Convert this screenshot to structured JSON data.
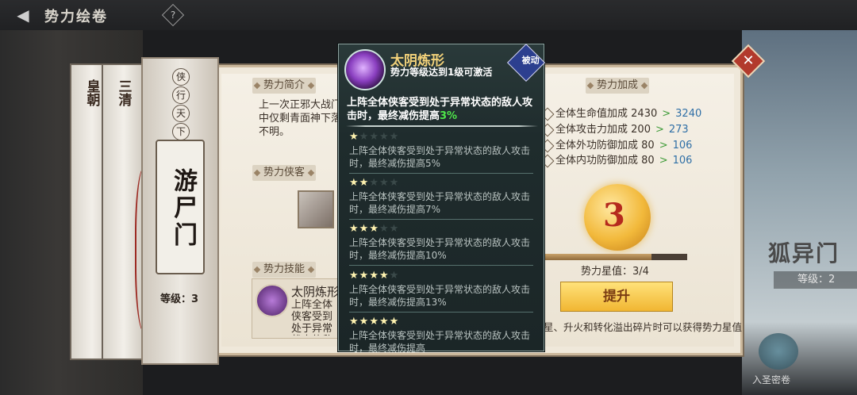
{
  "header": {
    "title": "势力绘卷",
    "help": "?"
  },
  "banner": {
    "motto": [
      "侠",
      "行",
      "天",
      "下"
    ],
    "name": "游尸门",
    "level_label": "等级：3"
  },
  "background": {
    "left_scrolls": [
      "皇朝",
      "三清"
    ],
    "right_card": {
      "name": "狐异门",
      "level": "等级：2"
    },
    "bottom_right_label": "入圣密卷"
  },
  "panel": {
    "intro_tag": "势力简介",
    "intro_text": "上一次正邪大战门中仅剩青面神下落不明。",
    "heroes_tag": "势力侠客",
    "skill_tag": "势力技能",
    "skill_name": "太阴炼形",
    "skill_desc": "上阵全体侠客受到处于异常状态的敌人攻击时，最终减",
    "bonus_tag": "势力加成",
    "bonuses": [
      {
        "label": "全体生命值加成",
        "current": "2430",
        "next": "3240"
      },
      {
        "label": "全体攻击力加成",
        "current": "200",
        "next": "273"
      },
      {
        "label": "全体外功防御加成",
        "current": "80",
        "next": "106"
      },
      {
        "label": "全体内功防御加成",
        "current": "80",
        "next": "106"
      }
    ],
    "star_medal": "3",
    "star_progress": 0.75,
    "star_value": "势力星值：3/4",
    "upgrade_button": "提升",
    "tip": "星、升火和转化溢出碎片时可以获得势力星值",
    "close": "✕"
  },
  "tooltip": {
    "title": "太阴炼形",
    "subtitle": "势力等级达到1级可激活",
    "badge": "被动",
    "main_text": "上阵全体侠客受到处于异常状态的敌人攻击时，最终减伤提高",
    "main_value": "3%",
    "tiers": [
      {
        "stars": 1,
        "text": "上阵全体侠客受到处于异常状态的敌人攻击时，最终减伤提高5%"
      },
      {
        "stars": 2,
        "text": "上阵全体侠客受到处于异常状态的敌人攻击时，最终减伤提高7%"
      },
      {
        "stars": 3,
        "text": "上阵全体侠客受到处于异常状态的敌人攻击时，最终减伤提高10%"
      },
      {
        "stars": 4,
        "text": "上阵全体侠客受到处于异常状态的敌人攻击时，最终减伤提高13%"
      },
      {
        "stars": 5,
        "text": "上阵全体侠客受到处于异常状态的敌人攻击时，最终减伤提高"
      }
    ]
  }
}
